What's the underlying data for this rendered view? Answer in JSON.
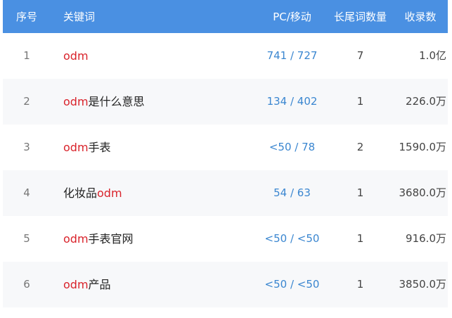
{
  "header": {
    "idx": "序号",
    "keyword": "关键词",
    "pc_mobile": "PC/移动",
    "longtail": "长尾词数量",
    "indexed": "收录数"
  },
  "colors": {
    "header_bg": "#4a90e2",
    "keyword_highlight": "#d9232b",
    "link_blue": "#3a86d0",
    "alt_row": "#f7f8fa"
  },
  "rows": [
    {
      "idx": "1",
      "kw_pre": "",
      "kw_hl": "odm",
      "kw_post": "",
      "pc_mobile": "741 / 727",
      "longtail": "7",
      "indexed": "1.0亿"
    },
    {
      "idx": "2",
      "kw_pre": "",
      "kw_hl": "odm",
      "kw_post": "是什么意思",
      "pc_mobile": "134 / 402",
      "longtail": "1",
      "indexed": "226.0万"
    },
    {
      "idx": "3",
      "kw_pre": "",
      "kw_hl": "odm",
      "kw_post": "手表",
      "pc_mobile": "<50 / 78",
      "longtail": "2",
      "indexed": "1590.0万"
    },
    {
      "idx": "4",
      "kw_pre": "化妆品",
      "kw_hl": "odm",
      "kw_post": "",
      "pc_mobile": "54 / 63",
      "longtail": "1",
      "indexed": "3680.0万"
    },
    {
      "idx": "5",
      "kw_pre": "",
      "kw_hl": "odm",
      "kw_post": "手表官网",
      "pc_mobile": "<50 / <50",
      "longtail": "1",
      "indexed": "916.0万"
    },
    {
      "idx": "6",
      "kw_pre": "",
      "kw_hl": "odm",
      "kw_post": "产品",
      "pc_mobile": "<50 / <50",
      "longtail": "1",
      "indexed": "3850.0万"
    }
  ]
}
